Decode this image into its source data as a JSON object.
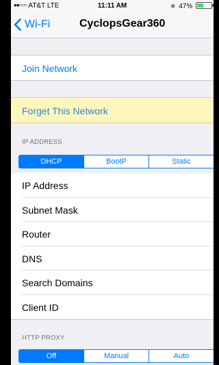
{
  "status_bar": {
    "carrier": "AT&T",
    "network": "LTE",
    "time": "11:11 AM",
    "battery": "47%",
    "battery_level": 0.47
  },
  "nav": {
    "back_label": "Wi-Fi",
    "title": "CyclopsGear360"
  },
  "join_network": "Join Network",
  "forget_network": "Forget This Network",
  "ip_section": {
    "header": "IP ADDRESS",
    "segments": [
      "DHCP",
      "BootP",
      "Static"
    ],
    "selected": "DHCP",
    "rows": [
      "IP Address",
      "Subnet Mask",
      "Router",
      "DNS",
      "Search Domains",
      "Client ID"
    ]
  },
  "proxy_section": {
    "header": "HTTP PROXY",
    "segments": [
      "Off",
      "Manual",
      "Auto"
    ],
    "selected": "Off"
  },
  "colors": {
    "accent": "#007aff",
    "highlight": "#fef6bd",
    "background": "#efeff4"
  }
}
